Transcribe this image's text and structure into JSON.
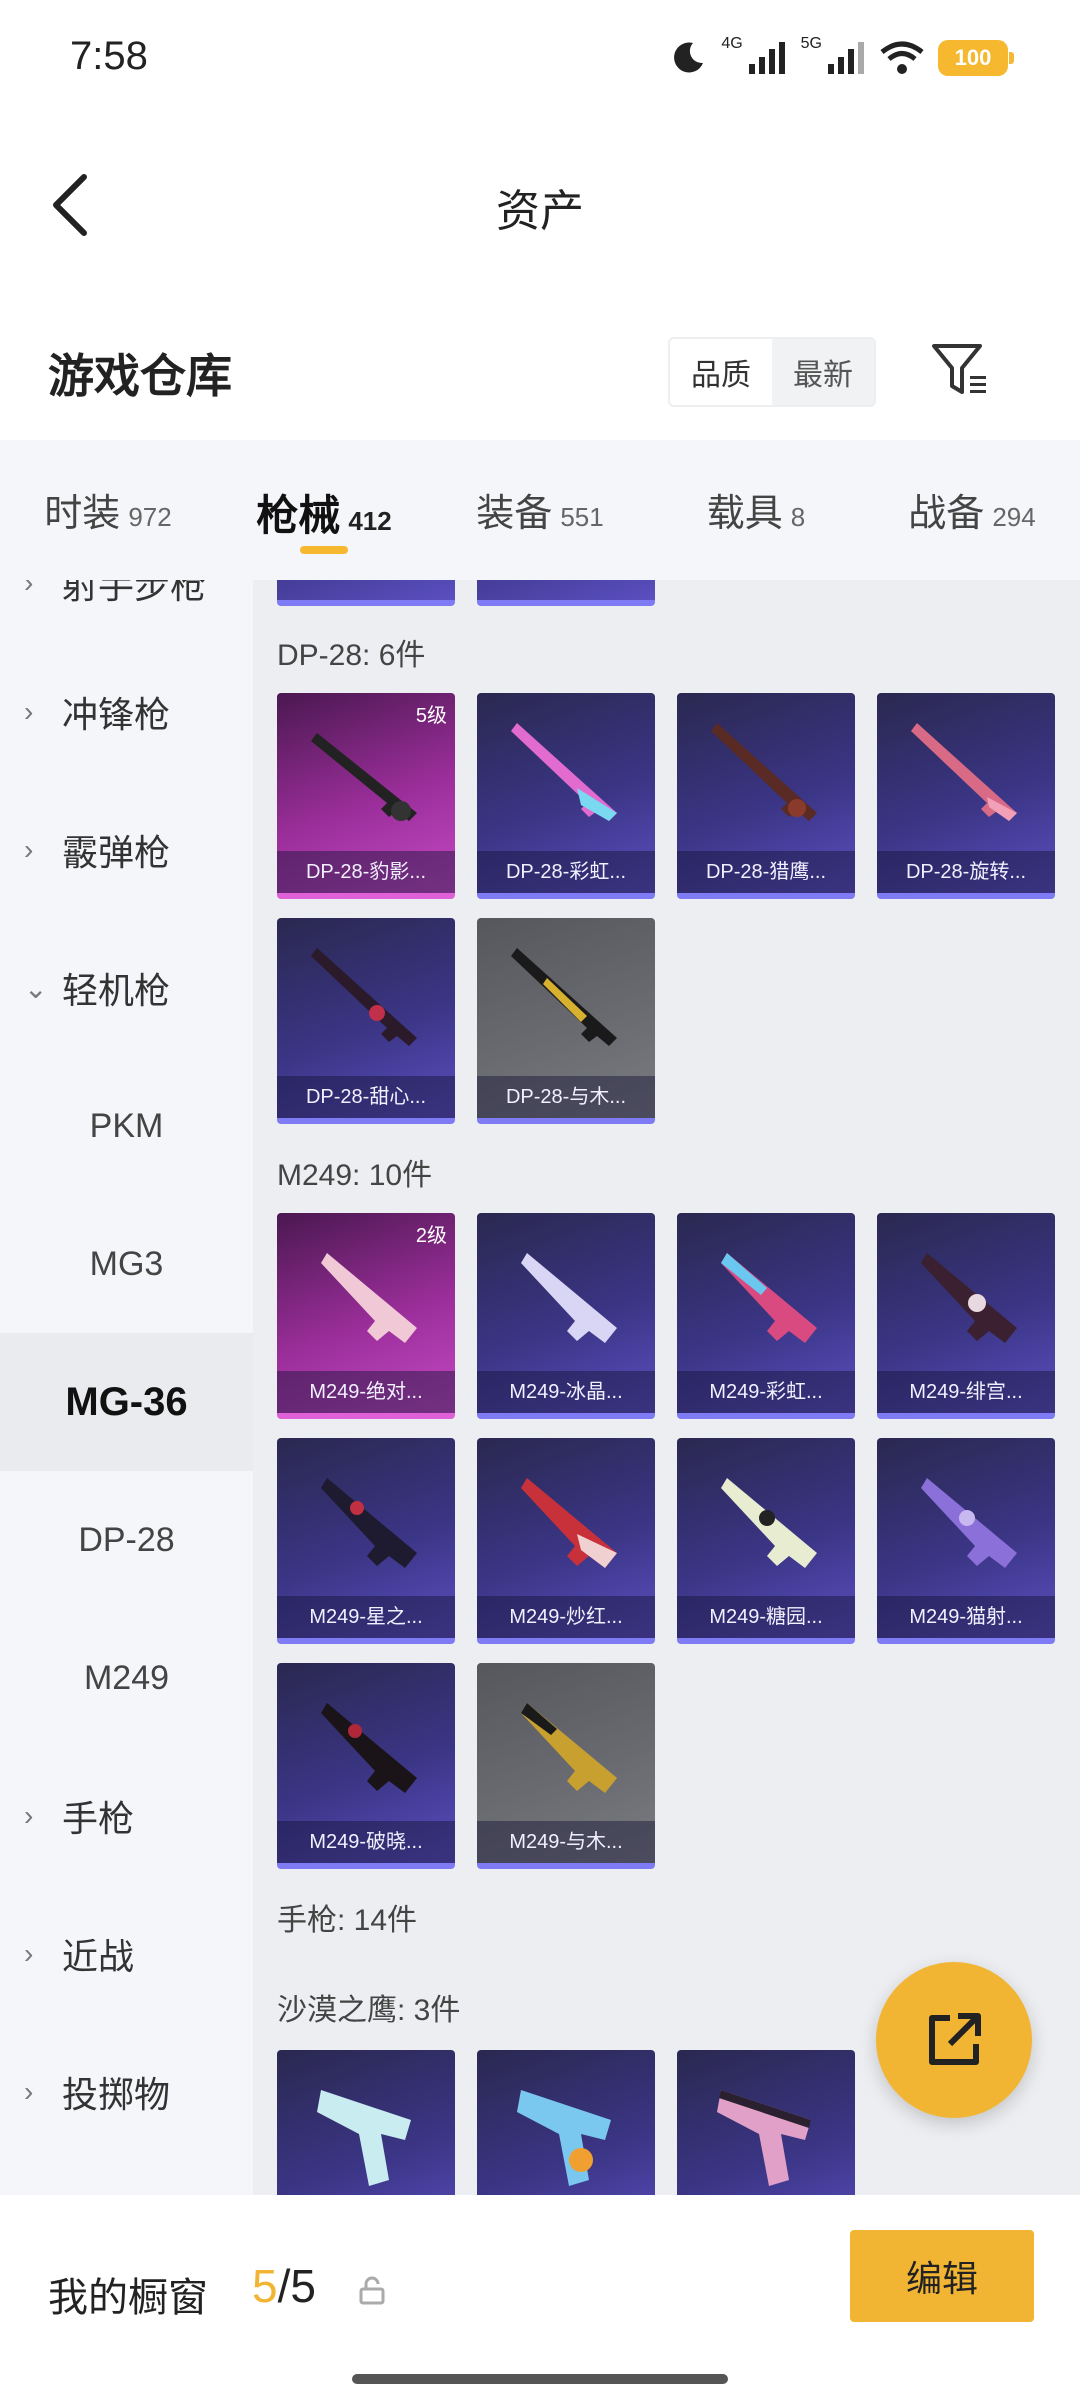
{
  "status_bar": {
    "time": "7:58",
    "network_1": "4G",
    "network_2": "5G",
    "battery": "100"
  },
  "header": {
    "title": "资产",
    "back_icon": "chevron-left-icon"
  },
  "section": {
    "title": "游戏仓库",
    "sort_options": [
      "品质",
      "最新"
    ],
    "filter_icon": "filter-icon"
  },
  "tabs": [
    {
      "label": "时装",
      "count": "972"
    },
    {
      "label": "枪械",
      "count": "412"
    },
    {
      "label": "装备",
      "count": "551"
    },
    {
      "label": "载具",
      "count": "8"
    },
    {
      "label": "战备",
      "count": "294"
    }
  ],
  "sidebar": [
    {
      "label": "射手步枪",
      "chevron": "›"
    },
    {
      "label": "冲锋枪",
      "chevron": "›"
    },
    {
      "label": "霰弹枪",
      "chevron": "›"
    },
    {
      "label": "轻机枪",
      "chevron": "⌄"
    },
    {
      "label": "PKM"
    },
    {
      "label": "MG3"
    },
    {
      "label": "MG-36"
    },
    {
      "label": "DP-28"
    },
    {
      "label": "M249"
    },
    {
      "label": "手枪",
      "chevron": "›"
    },
    {
      "label": "近战",
      "chevron": "›"
    },
    {
      "label": "投掷物",
      "chevron": "›"
    }
  ],
  "groups": {
    "dp28": {
      "label": "DP-28: 6件",
      "items": [
        {
          "name": "DP-28-豹影...",
          "tier": "5级",
          "style": "pink"
        },
        {
          "name": "DP-28-彩虹...",
          "style": "purple"
        },
        {
          "name": "DP-28-猎鹰...",
          "style": "purple"
        },
        {
          "name": "DP-28-旋转...",
          "style": "purple"
        },
        {
          "name": "DP-28-甜心...",
          "style": "purple"
        },
        {
          "name": "DP-28-与木...",
          "style": "gray"
        }
      ]
    },
    "m249": {
      "label": "M249: 10件",
      "items": [
        {
          "name": "M249-绝对...",
          "tier": "2级",
          "style": "pink"
        },
        {
          "name": "M249-冰晶...",
          "style": "purple"
        },
        {
          "name": "M249-彩虹...",
          "style": "purple"
        },
        {
          "name": "M249-绯宫...",
          "style": "purple"
        },
        {
          "name": "M249-星之...",
          "style": "purple"
        },
        {
          "name": "M249-炒红...",
          "style": "purple"
        },
        {
          "name": "M249-糖园...",
          "style": "purple"
        },
        {
          "name": "M249-猫射...",
          "style": "purple"
        },
        {
          "name": "M249-破晓...",
          "style": "purple"
        },
        {
          "name": "M249-与木...",
          "style": "gray"
        }
      ]
    },
    "pistol": {
      "label": "手枪: 14件"
    },
    "deagle": {
      "label": "沙漠之鹰: 3件"
    }
  },
  "bottom": {
    "showcase_label": "我的橱窗",
    "showcase_current": "5",
    "showcase_total": "/5",
    "edit_label": "编辑"
  }
}
